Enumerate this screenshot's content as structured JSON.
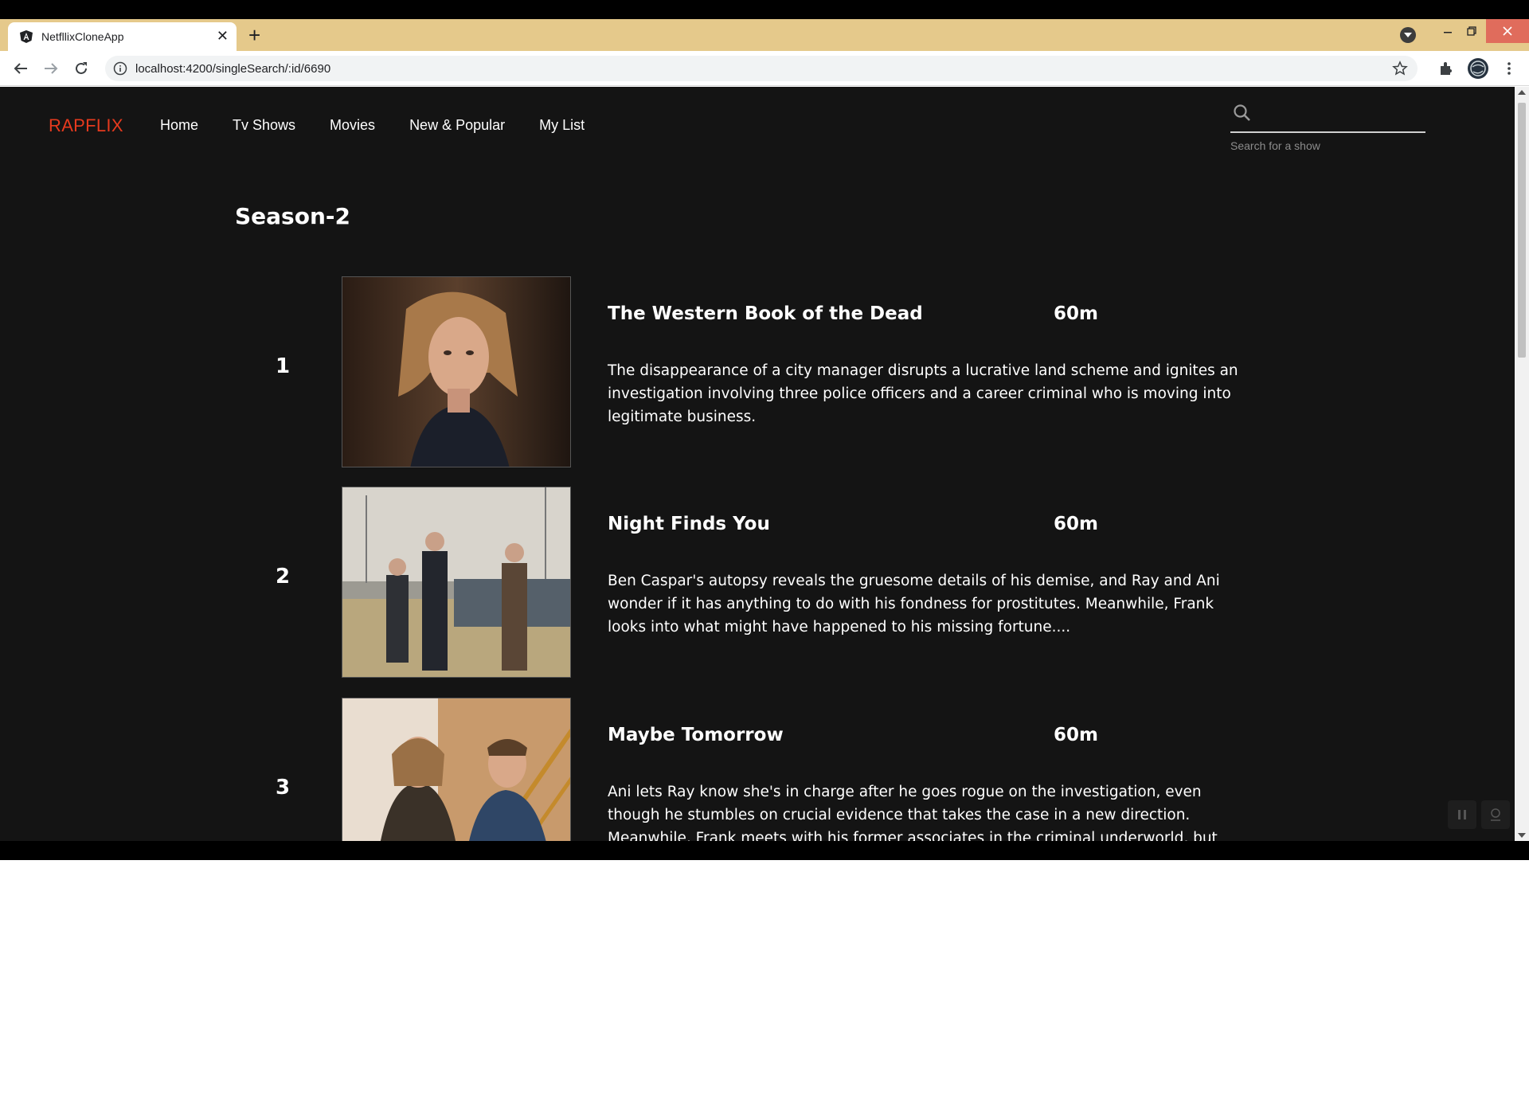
{
  "browser": {
    "tab_title": "NetfllixCloneApp",
    "url": "localhost:4200/singleSearch/:id/6690",
    "colors": {
      "tab_strip": "#e5c98b",
      "close_button": "#e06c5c"
    }
  },
  "nav": {
    "logo": "RAPFLIX",
    "links": [
      "Home",
      "Tv Shows",
      "Movies",
      "New & Popular",
      "My List"
    ],
    "search_hint": "Search for a show",
    "search_value": "",
    "colors": {
      "logo": "#e63a1e",
      "background": "#141414"
    }
  },
  "season": {
    "title": "Season-2"
  },
  "episodes": [
    {
      "number": "1",
      "title": "The Western Book of the Dead",
      "runtime": "60m",
      "description": "The disappearance of a city manager disrupts a lucrative land scheme and ignites an investigation involving three police officers and a career criminal who is moving into legitimate business.",
      "thumbnail": "woman-portrait"
    },
    {
      "number": "2",
      "title": "Night Finds You",
      "runtime": "60m",
      "description": "Ben Caspar's autopsy reveals the gruesome details of his demise, and Ray and Ani wonder if it has anything to do with his fondness for prostitutes. Meanwhile, Frank looks into what might have happened to his missing fortune....",
      "thumbnail": "three-men-outdoors"
    },
    {
      "number": "3",
      "title": "Maybe Tomorrow",
      "runtime": "60m",
      "description": "Ani lets Ray know she's in charge after he goes rogue on the investigation, even though he stumbles on crucial evidence that takes the case in a new direction. Meanwhile, Frank meets with his former associates in the criminal underworld, but they make it clear they're not taking",
      "thumbnail": "couple-on-staircase"
    }
  ]
}
